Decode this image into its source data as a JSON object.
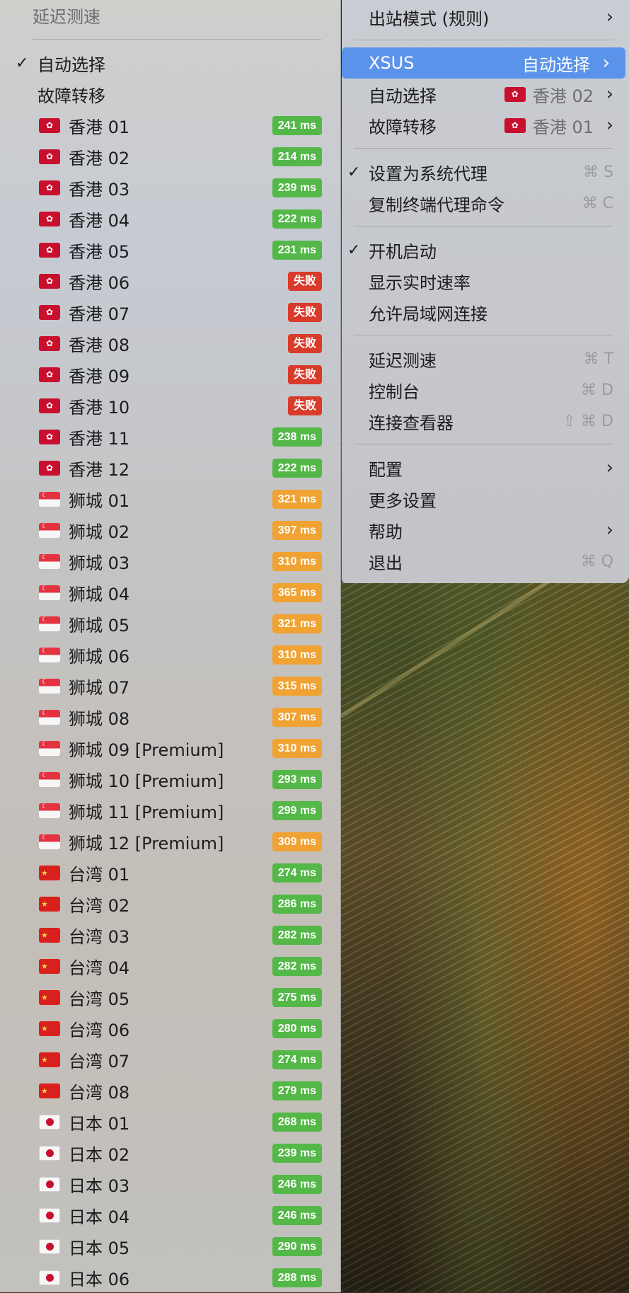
{
  "colors": {
    "fast_badge": "#54b848",
    "medium_badge": "#f0a233",
    "fail_badge": "#d83b2a",
    "selection": "#5c93ea"
  },
  "proxy_menu": {
    "section_title": "延迟测速",
    "auto_select": "自动选择",
    "failover": "故障转移",
    "nodes": [
      {
        "flag": "hk",
        "name": "香港 01",
        "latency": "241 ms",
        "status": "fast"
      },
      {
        "flag": "hk",
        "name": "香港 02",
        "latency": "214 ms",
        "status": "fast"
      },
      {
        "flag": "hk",
        "name": "香港 03",
        "latency": "239 ms",
        "status": "fast"
      },
      {
        "flag": "hk",
        "name": "香港 04",
        "latency": "222 ms",
        "status": "fast"
      },
      {
        "flag": "hk",
        "name": "香港 05",
        "latency": "231 ms",
        "status": "fast"
      },
      {
        "flag": "hk",
        "name": "香港 06",
        "latency": "失败",
        "status": "fail"
      },
      {
        "flag": "hk",
        "name": "香港 07",
        "latency": "失败",
        "status": "fail"
      },
      {
        "flag": "hk",
        "name": "香港 08",
        "latency": "失败",
        "status": "fail"
      },
      {
        "flag": "hk",
        "name": "香港 09",
        "latency": "失败",
        "status": "fail"
      },
      {
        "flag": "hk",
        "name": "香港 10",
        "latency": "失败",
        "status": "fail"
      },
      {
        "flag": "hk",
        "name": "香港 11",
        "latency": "238 ms",
        "status": "fast"
      },
      {
        "flag": "hk",
        "name": "香港 12",
        "latency": "222 ms",
        "status": "fast"
      },
      {
        "flag": "sg",
        "name": "狮城 01",
        "latency": "321 ms",
        "status": "medium"
      },
      {
        "flag": "sg",
        "name": "狮城 02",
        "latency": "397 ms",
        "status": "medium"
      },
      {
        "flag": "sg",
        "name": "狮城 03",
        "latency": "310 ms",
        "status": "medium"
      },
      {
        "flag": "sg",
        "name": "狮城 04",
        "latency": "365 ms",
        "status": "medium"
      },
      {
        "flag": "sg",
        "name": "狮城 05",
        "latency": "321 ms",
        "status": "medium"
      },
      {
        "flag": "sg",
        "name": "狮城 06",
        "latency": "310 ms",
        "status": "medium"
      },
      {
        "flag": "sg",
        "name": "狮城 07",
        "latency": "315 ms",
        "status": "medium"
      },
      {
        "flag": "sg",
        "name": "狮城 08",
        "latency": "307 ms",
        "status": "medium"
      },
      {
        "flag": "sg",
        "name": "狮城 09 [Premium]",
        "latency": "310 ms",
        "status": "medium"
      },
      {
        "flag": "sg",
        "name": "狮城 10 [Premium]",
        "latency": "293 ms",
        "status": "fast"
      },
      {
        "flag": "sg",
        "name": "狮城 11 [Premium]",
        "latency": "299 ms",
        "status": "fast"
      },
      {
        "flag": "sg",
        "name": "狮城 12 [Premium]",
        "latency": "309 ms",
        "status": "medium"
      },
      {
        "flag": "cn",
        "name": "台湾 01",
        "latency": "274 ms",
        "status": "fast"
      },
      {
        "flag": "cn",
        "name": "台湾 02",
        "latency": "286 ms",
        "status": "fast"
      },
      {
        "flag": "cn",
        "name": "台湾 03",
        "latency": "282 ms",
        "status": "fast"
      },
      {
        "flag": "cn",
        "name": "台湾 04",
        "latency": "282 ms",
        "status": "fast"
      },
      {
        "flag": "cn",
        "name": "台湾 05",
        "latency": "275 ms",
        "status": "fast"
      },
      {
        "flag": "cn",
        "name": "台湾 06",
        "latency": "280 ms",
        "status": "fast"
      },
      {
        "flag": "cn",
        "name": "台湾 07",
        "latency": "274 ms",
        "status": "fast"
      },
      {
        "flag": "cn",
        "name": "台湾 08",
        "latency": "279 ms",
        "status": "fast"
      },
      {
        "flag": "jp",
        "name": "日本 01",
        "latency": "268 ms",
        "status": "fast"
      },
      {
        "flag": "jp",
        "name": "日本 02",
        "latency": "239 ms",
        "status": "fast"
      },
      {
        "flag": "jp",
        "name": "日本 03",
        "latency": "246 ms",
        "status": "fast"
      },
      {
        "flag": "jp",
        "name": "日本 04",
        "latency": "246 ms",
        "status": "fast"
      },
      {
        "flag": "jp",
        "name": "日本 05",
        "latency": "290 ms",
        "status": "fast"
      },
      {
        "flag": "jp",
        "name": "日本 06",
        "latency": "288 ms",
        "status": "fast"
      }
    ]
  },
  "main_menu": {
    "outbound_mode": "出站模式 (规则)",
    "xsus_label": "XSUS",
    "xsus_value": "自动选择",
    "auto_select_label": "自动选择",
    "auto_select_value": "香港 02",
    "failover_label": "故障转移",
    "failover_value": "香港 01",
    "set_system_proxy": "设置为系统代理",
    "set_system_proxy_shortcut": "⌘ S",
    "copy_terminal_cmd": "复制终端代理命令",
    "copy_terminal_cmd_shortcut": "⌘ C",
    "launch_at_login": "开机启动",
    "show_realtime_speed": "显示实时速率",
    "allow_lan": "允许局域网连接",
    "latency_test": "延迟测速",
    "latency_test_shortcut": "⌘ T",
    "dashboard": "控制台",
    "dashboard_shortcut": "⌘ D",
    "connection_viewer": "连接查看器",
    "connection_viewer_shortcut": "⇧ ⌘ D",
    "config": "配置",
    "more_settings": "更多设置",
    "help": "帮助",
    "quit": "退出",
    "quit_shortcut": "⌘ Q",
    "check_glyph": "✓",
    "chevron_glyph": "›"
  }
}
